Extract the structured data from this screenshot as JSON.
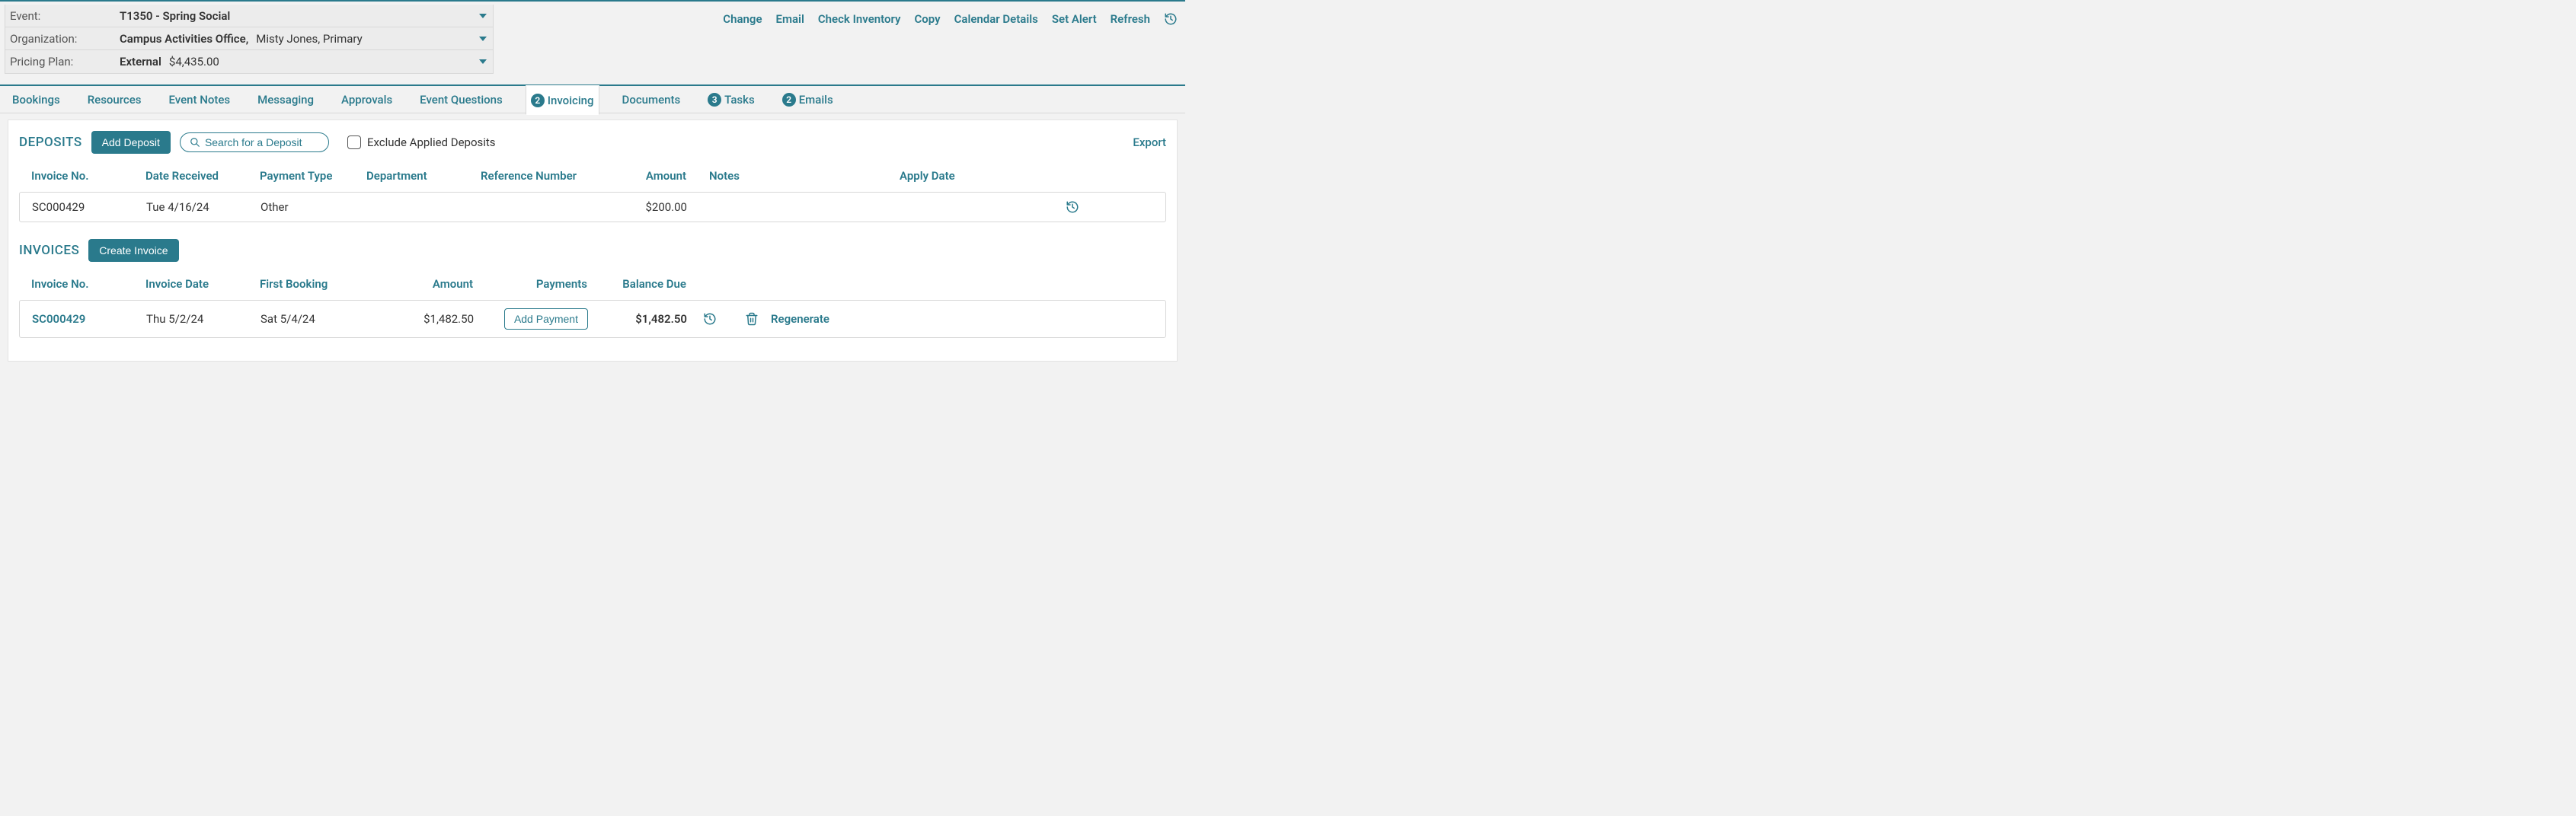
{
  "header": {
    "event_label": "Event:",
    "event_value": "T1350 - Spring Social",
    "org_label": "Organization:",
    "org_value_bold": "Campus Activities Office,",
    "org_value_rest": "Misty Jones,  Primary",
    "plan_label": "Pricing Plan:",
    "plan_value_bold": "External",
    "plan_amount": "$4,435.00"
  },
  "actions": {
    "change": "Change",
    "email": "Email",
    "check_inventory": "Check Inventory",
    "copy": "Copy",
    "calendar_details": "Calendar Details",
    "set_alert": "Set Alert",
    "refresh": "Refresh"
  },
  "tabs": {
    "bookings": "Bookings",
    "resources": "Resources",
    "event_notes": "Event Notes",
    "messaging": "Messaging",
    "approvals": "Approvals",
    "event_questions": "Event Questions",
    "invoicing": "Invoicing",
    "invoicing_badge": "2",
    "documents": "Documents",
    "tasks": "Tasks",
    "tasks_badge": "3",
    "emails": "Emails",
    "emails_badge": "2"
  },
  "deposits": {
    "title": "DEPOSITS",
    "add_btn": "Add Deposit",
    "search_placeholder": "Search for a Deposit",
    "exclude_label": "Exclude Applied Deposits",
    "export": "Export",
    "cols": {
      "invoice_no": "Invoice No.",
      "date_received": "Date Received",
      "payment_type": "Payment Type",
      "department": "Department",
      "reference_number": "Reference Number",
      "amount": "Amount",
      "notes": "Notes",
      "apply_date": "Apply Date"
    },
    "row": {
      "invoice_no": "SC000429",
      "date_received": "Tue 4/16/24",
      "payment_type": "Other",
      "department": "",
      "reference_number": "",
      "amount": "$200.00",
      "notes": "",
      "apply_date": ""
    }
  },
  "invoices": {
    "title": "INVOICES",
    "create_btn": "Create Invoice",
    "cols": {
      "invoice_no": "Invoice No.",
      "invoice_date": "Invoice Date",
      "first_booking": "First Booking",
      "amount": "Amount",
      "payments": "Payments",
      "balance_due": "Balance Due"
    },
    "row": {
      "invoice_no": "SC000429",
      "invoice_date": "Thu 5/2/24",
      "first_booking": "Sat 5/4/24",
      "amount": "$1,482.50",
      "add_payment": "Add Payment",
      "balance_due": "$1,482.50",
      "regenerate": "Regenerate"
    }
  }
}
